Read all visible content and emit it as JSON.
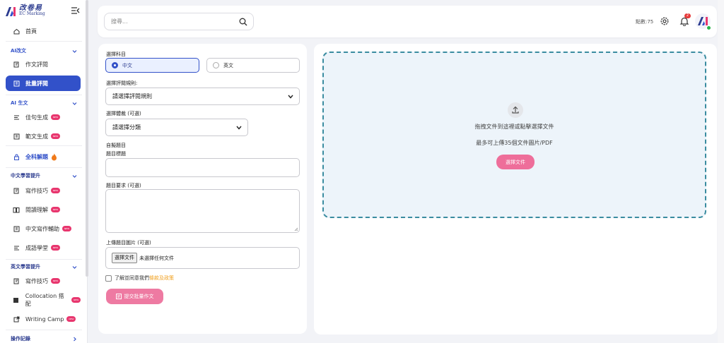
{
  "brand": {
    "name_cn": "改卷易",
    "name_en": "EC Marking"
  },
  "sidebar": {
    "home": "首頁",
    "groups": [
      {
        "label": "AI改文",
        "items": [
          {
            "label": "作文評閱"
          },
          {
            "label": "批量評閱",
            "active": true
          }
        ]
      },
      {
        "label": "AI 生文",
        "items": [
          {
            "label": "佳句生成",
            "badge": "NEW"
          },
          {
            "label": "範文生成",
            "badge": "NEW"
          }
        ]
      },
      {
        "label": "全科解題",
        "items": []
      },
      {
        "label": "中文學習提升",
        "items": [
          {
            "label": "寫作技巧",
            "badge": "NEW"
          },
          {
            "label": "閱讀理解",
            "badge": "NEW"
          },
          {
            "label": "中文寫作輔助",
            "badge": "NEW"
          },
          {
            "label": "成語學堂",
            "badge": "NEW"
          }
        ]
      },
      {
        "label": "英文學習提升",
        "items": [
          {
            "label": "寫作技巧",
            "badge": "NEW"
          },
          {
            "label": "Collocation 搭配",
            "badge": "NEW"
          },
          {
            "label": "Writing Camp",
            "badge": "NEW"
          }
        ]
      },
      {
        "label": "操作記錄",
        "items": []
      }
    ]
  },
  "topbar": {
    "search_placeholder": "搜尋...",
    "points_label": "點數:75",
    "notification_count": "2"
  },
  "form": {
    "subject_label": "選擇科目",
    "subject_options": [
      {
        "label": "中文",
        "selected": true
      },
      {
        "label": "英文",
        "selected": false
      }
    ],
    "rule_label": "選擇評閱規則:",
    "rule_value": "請選擇評閱規則",
    "genre_label": "選擇體裁 (可選)",
    "genre_value": "請選擇分類",
    "custom_topic_label": "自擬題目",
    "topic_title_label": "題目標題",
    "topic_req_label": "題目要求 (可選)",
    "upload_img_label": "上傳題目圖片 (可選)",
    "file_button": "選擇文件",
    "file_status": "未選擇任何文件",
    "agree_text": "了解並同意我們",
    "agree_link": "條款及政策",
    "submit_label": "提交批量作文"
  },
  "upload": {
    "instruction": "拖拽文件到這裡或點擊選擇文件",
    "limit": "最多可上傳35個文件圖片/PDF",
    "choose_button": "選擇文件"
  },
  "colors": {
    "primary": "#3251c9",
    "pink": "#ee6e9a",
    "badge": "#e8366e",
    "dashed": "#3a8ca0"
  }
}
